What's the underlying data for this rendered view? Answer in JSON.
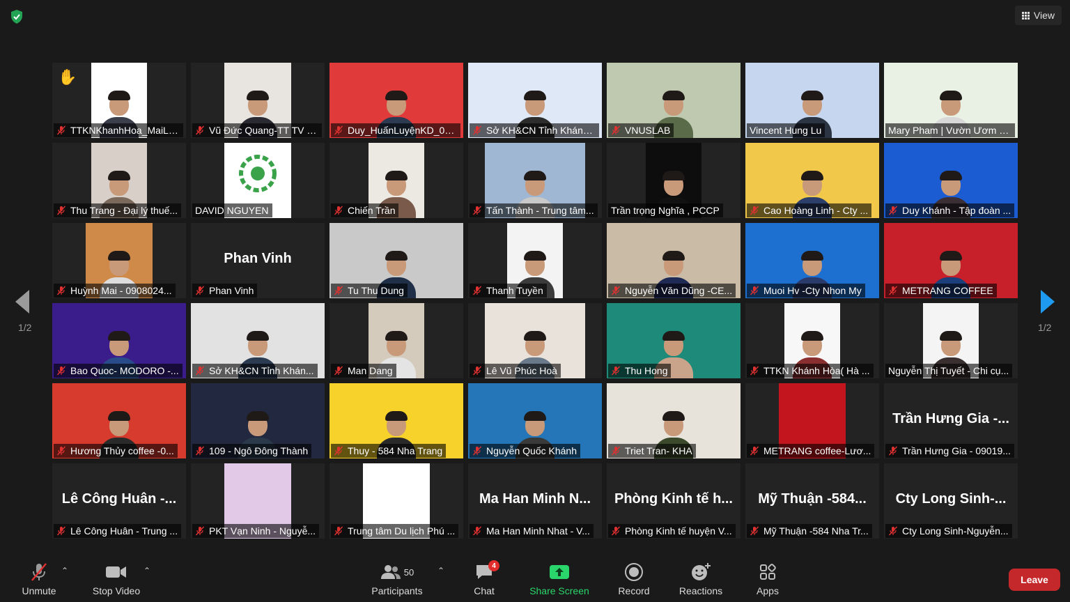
{
  "header": {
    "view_label": "View"
  },
  "pagination": {
    "left_indicator": "1/2",
    "right_indicator": "1/2"
  },
  "tiles": [
    {
      "name": "TTKNKhanhHoa_MaiLe...",
      "hand": true
    },
    {
      "name": "Vũ Đức Quang-TT TV c..."
    },
    {
      "name": "Duy_HuấnLuyệnKD_09..."
    },
    {
      "name": "Sở KH&CN Tỉnh Khánh H..."
    },
    {
      "name": "VNUSLAB"
    },
    {
      "name": "Vincent Hung Lu",
      "active": true,
      "unmuted": true
    },
    {
      "name": "Mary Pham | Vườn Ươm K...",
      "unmuted": true
    },
    {
      "name": "Thu Trang - Đại lý thuế..."
    },
    {
      "name": "DAVID NGUYEN",
      "unmuted": true
    },
    {
      "name": "Chiến Trần"
    },
    {
      "name": "Tấn Thành - Trung tâm..."
    },
    {
      "name": "Trần trọng Nghĩa , PCCP",
      "unmuted": true
    },
    {
      "name": "Cao Hoàng Linh - Cty ..."
    },
    {
      "name": "Duy Khánh - Tập đoàn ..."
    },
    {
      "name": "Huỳnh Mai - 0908024..."
    },
    {
      "name": "Phan Vinh",
      "big": "Phan Vinh"
    },
    {
      "name": "Tu Thu Dung"
    },
    {
      "name": "Thanh Tuyền"
    },
    {
      "name": "Nguyễn Văn Dũng -CE..."
    },
    {
      "name": "Muoi Hv -Cty Nhon My"
    },
    {
      "name": "METRANG COFFEE"
    },
    {
      "name": "Bao Quoc- MODORO -..."
    },
    {
      "name": "Sở KH&CN Tỉnh Khán..."
    },
    {
      "name": "Man Dang"
    },
    {
      "name": "Lê Vũ Phúc Hoà"
    },
    {
      "name": "Thu Hong"
    },
    {
      "name": "TTKN Khánh Hòa( Hà ..."
    },
    {
      "name": "Nguyễn Thị Tuyết - Chi cụ...",
      "unmuted": true
    },
    {
      "name": "Hương Thủy coffee -0..."
    },
    {
      "name": "109 - Ngô Đông Thành"
    },
    {
      "name": "Thuy - 584 Nha Trang"
    },
    {
      "name": "Nguyễn Quốc Khánh"
    },
    {
      "name": "Triet Tran- KHA"
    },
    {
      "name": "METRANG coffee-Lươ..."
    },
    {
      "name": "Trần Hưng Gia - 09019...",
      "big": "Trần Hưng Gia -..."
    },
    {
      "name": "Lê Công Huân - Trung ...",
      "big": "Lê Công Huân -..."
    },
    {
      "name": "PKT Vạn Ninh - Nguyễ..."
    },
    {
      "name": "Trung tâm Du lịch Phú ..."
    },
    {
      "name": "Ma Han Minh Nhat - V...",
      "big": "Ma Han Minh N..."
    },
    {
      "name": "Phòng Kinh tế huyện V...",
      "big": "Phòng Kinh tế h..."
    },
    {
      "name": "Mỹ Thuận -584 Nha Tr...",
      "big": "Mỹ Thuận -584..."
    },
    {
      "name": "Cty Long Sinh-Nguyễn...",
      "big": "Cty Long Sinh-..."
    }
  ],
  "toolbar": {
    "unmute_label": "Unmute",
    "stop_video_label": "Stop Video",
    "participants_label": "Participants",
    "participants_count": "50",
    "chat_label": "Chat",
    "chat_badge": "4",
    "share_label": "Share Screen",
    "record_label": "Record",
    "reactions_label": "Reactions",
    "apps_label": "Apps",
    "leave_label": "Leave"
  }
}
